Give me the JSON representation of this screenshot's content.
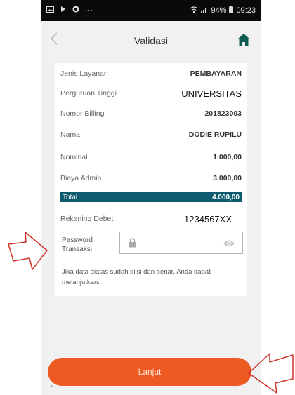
{
  "status_bar": {
    "battery": "94%",
    "time": "09:23",
    "dots": "···"
  },
  "header": {
    "title": "Validasi"
  },
  "details": [
    {
      "label": "Jenis Layanan",
      "value": "PEMBAYARAN"
    },
    {
      "label": "Perguruan Tinggi",
      "value": "UNIVERSITAS"
    },
    {
      "label": "Nomor Billing",
      "value": "201823003"
    },
    {
      "label": "Nama",
      "value": "DODIE RUPILU"
    },
    {
      "label": "Nominal",
      "value": "1.000,00"
    },
    {
      "label": "Biaya Admin",
      "value": "3.000,00"
    }
  ],
  "total": {
    "label": "Total",
    "value": "4.000,00"
  },
  "debit_account": {
    "label": "Rekening Debet",
    "value": "1234567XX"
  },
  "password": {
    "label_line1": "Password",
    "label_line2": "Transaksi",
    "placeholder": ""
  },
  "note": "Jika data diatas sudah diisi dan benar, Anda dapat melanjutkan.",
  "action": {
    "label": "Lanjut"
  },
  "stray_mark": "`",
  "colors": {
    "accent": "#ec5a22",
    "total_bar": "#0e5a6e",
    "home_icon": "#0e5a4e",
    "arrow": "#d0322a"
  }
}
